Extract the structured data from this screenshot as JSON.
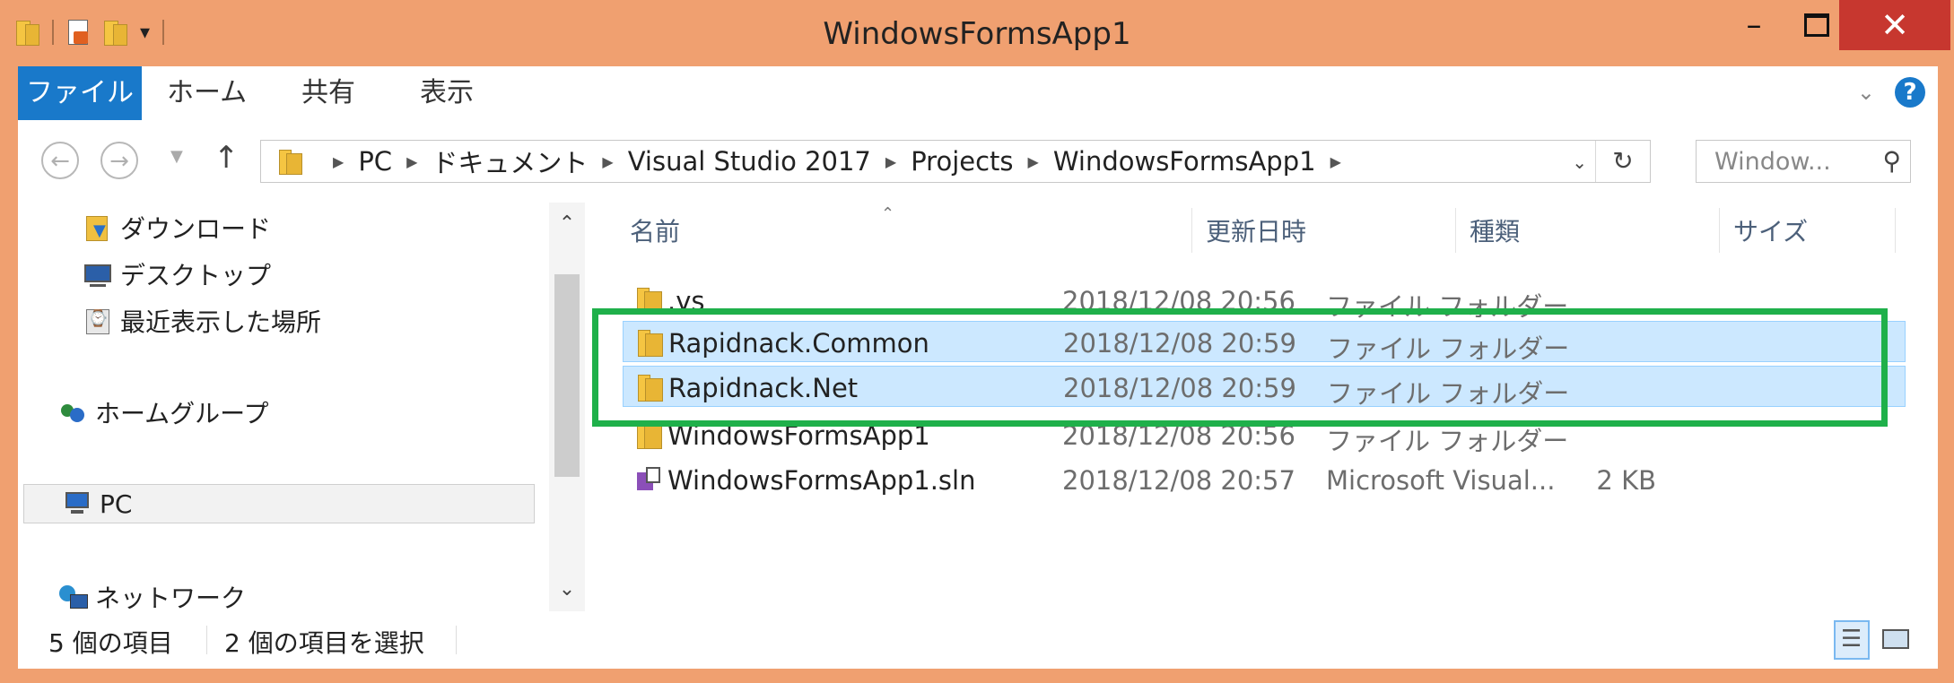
{
  "window": {
    "title": "WindowsFormsApp1",
    "min_icon": "minimize-icon",
    "max_icon": "maximize-icon",
    "close_glyph": "✕",
    "min_glyph": "–"
  },
  "ribbon": {
    "tabs": [
      "ファイル",
      "ホーム",
      "共有",
      "表示"
    ],
    "accent": "#1979ca"
  },
  "nav": {
    "breadcrumbs": [
      "PC",
      "ドキュメント",
      "Visual Studio 2017",
      "Projects",
      "WindowsFormsApp1"
    ],
    "search_placeholder": "Window..."
  },
  "sidebar": {
    "items": [
      {
        "label": "ダウンロード",
        "icon": "download-folder-icon"
      },
      {
        "label": "デスクトップ",
        "icon": "desktop-icon"
      },
      {
        "label": "最近表示した場所",
        "icon": "recent-places-icon"
      },
      {
        "label": "ホームグループ",
        "icon": "homegroup-icon"
      },
      {
        "label": "PC",
        "icon": "pc-icon",
        "selected": true
      },
      {
        "label": "ネットワーク",
        "icon": "network-icon"
      }
    ]
  },
  "columns": {
    "name": "名前",
    "date": "更新日時",
    "type": "種類",
    "size": "サイズ"
  },
  "files": [
    {
      "name": ".vs",
      "date": "2018/12/08 20:56",
      "type": "ファイル フォルダー",
      "size": "",
      "icon": "folder-icon",
      "selected": false
    },
    {
      "name": "Rapidnack.Common",
      "date": "2018/12/08 20:59",
      "type": "ファイル フォルダー",
      "size": "",
      "icon": "folder-icon",
      "selected": true
    },
    {
      "name": "Rapidnack.Net",
      "date": "2018/12/08 20:59",
      "type": "ファイル フォルダー",
      "size": "",
      "icon": "folder-icon",
      "selected": true
    },
    {
      "name": "WindowsFormsApp1",
      "date": "2018/12/08 20:56",
      "type": "ファイル フォルダー",
      "size": "",
      "icon": "folder-icon",
      "selected": false
    },
    {
      "name": "WindowsFormsApp1.sln",
      "date": "2018/12/08 20:57",
      "type": "Microsoft Visual...",
      "size": "2 KB",
      "icon": "sln-file-icon",
      "selected": false
    }
  ],
  "status": {
    "item_count": "5 個の項目",
    "selected_count": "2 個の項目を選択"
  },
  "highlight_color": "#1fb04a"
}
